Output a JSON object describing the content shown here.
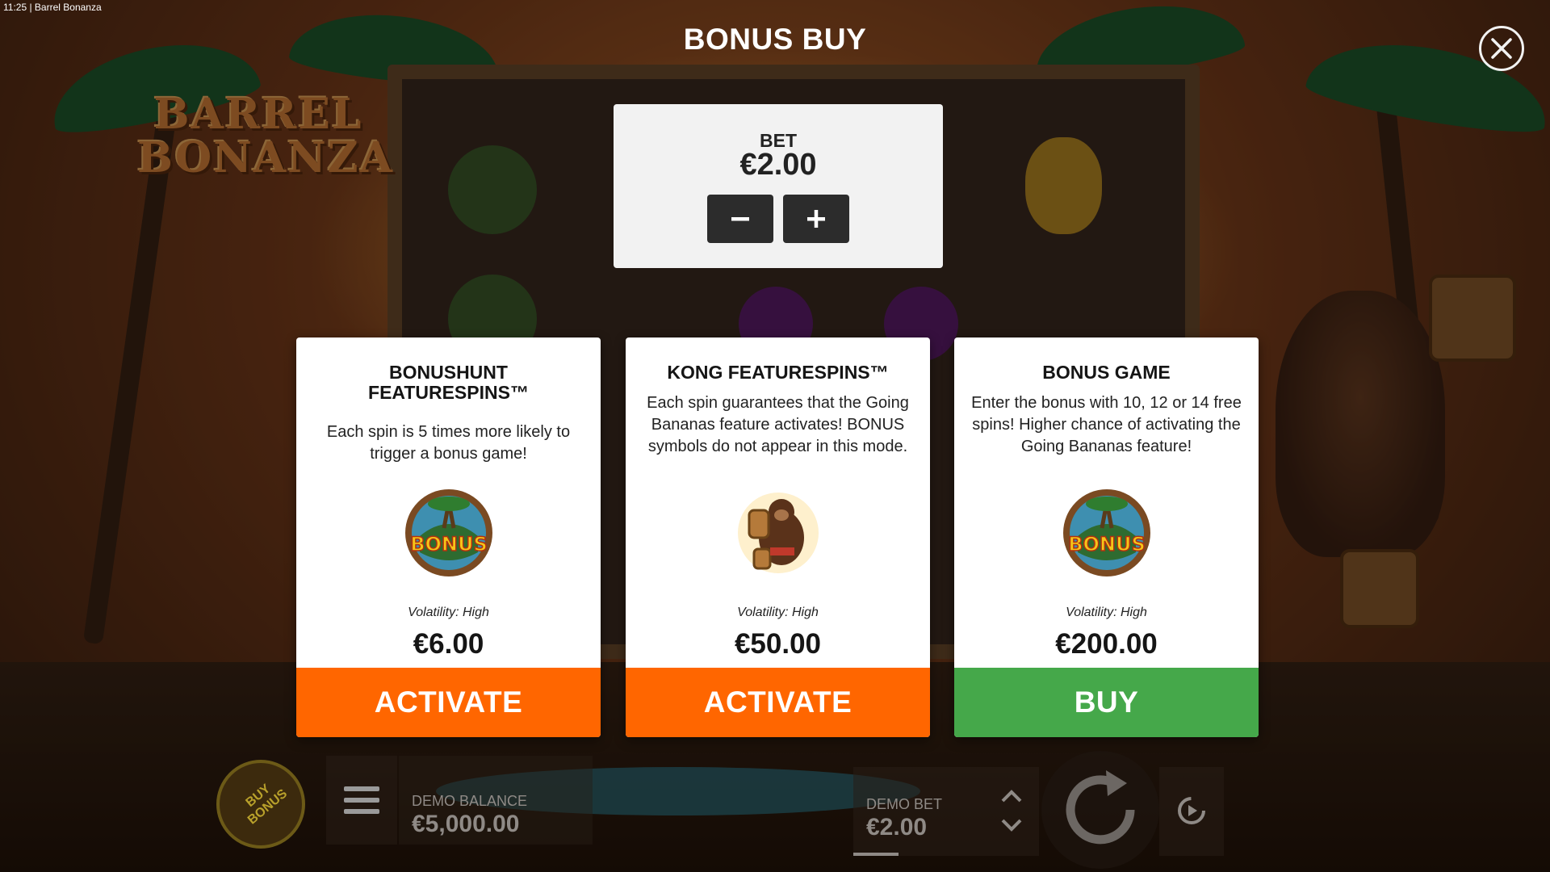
{
  "system": {
    "time_title": "11:25  |  Barrel Bonanza"
  },
  "game": {
    "logo_line1": "BARREL",
    "logo_line2": "BONANZA"
  },
  "modal": {
    "title": "BONUS BUY",
    "bet": {
      "label": "BET",
      "value": "€2.00"
    }
  },
  "cards": [
    {
      "title_line1": "BONUSHUNT",
      "title_line2": "FEATURESPINS™",
      "description": "Each spin is 5 times more likely to trigger a bonus game!",
      "icon": "bonus-coin-icon",
      "volatility": "Volatility: High",
      "price": "€6.00",
      "action": "ACTIVATE",
      "action_color": "#ff6600"
    },
    {
      "title_line1": "KONG FEATURESPINS™",
      "title_line2": "",
      "description": "Each spin guarantees that the Going Bananas feature activates! BONUS symbols do not appear in this mode.",
      "icon": "gorilla-icon",
      "volatility": "Volatility: High",
      "price": "€50.00",
      "action": "ACTIVATE",
      "action_color": "#ff6600"
    },
    {
      "title_line1": "BONUS GAME",
      "title_line2": "",
      "description": "Enter the bonus with 10, 12 or 14 free spins! Higher chance of activating the Going Bananas feature!",
      "icon": "bonus-coin-icon",
      "volatility": "Volatility: High",
      "price": "€200.00",
      "action": "BUY",
      "action_color": "#45a84a"
    }
  ],
  "hud": {
    "buy_bonus_label": "BUY BONUS",
    "balance_label": "DEMO BALANCE",
    "balance_value": "€5,000.00",
    "bet_label": "DEMO BET",
    "bet_value": "€2.00"
  },
  "icon_bonus_text": "BONUS"
}
